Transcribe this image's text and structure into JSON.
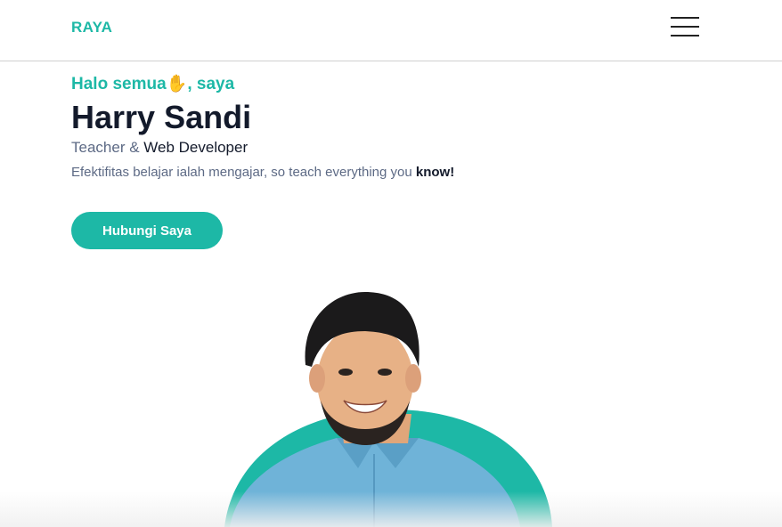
{
  "navbar": {
    "brand": "RAYA",
    "menu_icon": "hamburger-menu-icon"
  },
  "hero": {
    "greeting_before": "Halo semua",
    "greeting_emoji": "✋",
    "greeting_after": ", saya",
    "name": "Harry Sandi",
    "role_prefix": "Teacher & ",
    "role_highlight": "Web Developer",
    "tagline_text": "Efektifitas belajar ialah mengajar, so teach everything you ",
    "tagline_bold": "know!",
    "cta_label": "Hubungi Saya"
  },
  "colors": {
    "accent": "#1db8a6",
    "heading": "#131a2b",
    "muted": "#5d6a85",
    "shirt": "#6fb3d8"
  }
}
